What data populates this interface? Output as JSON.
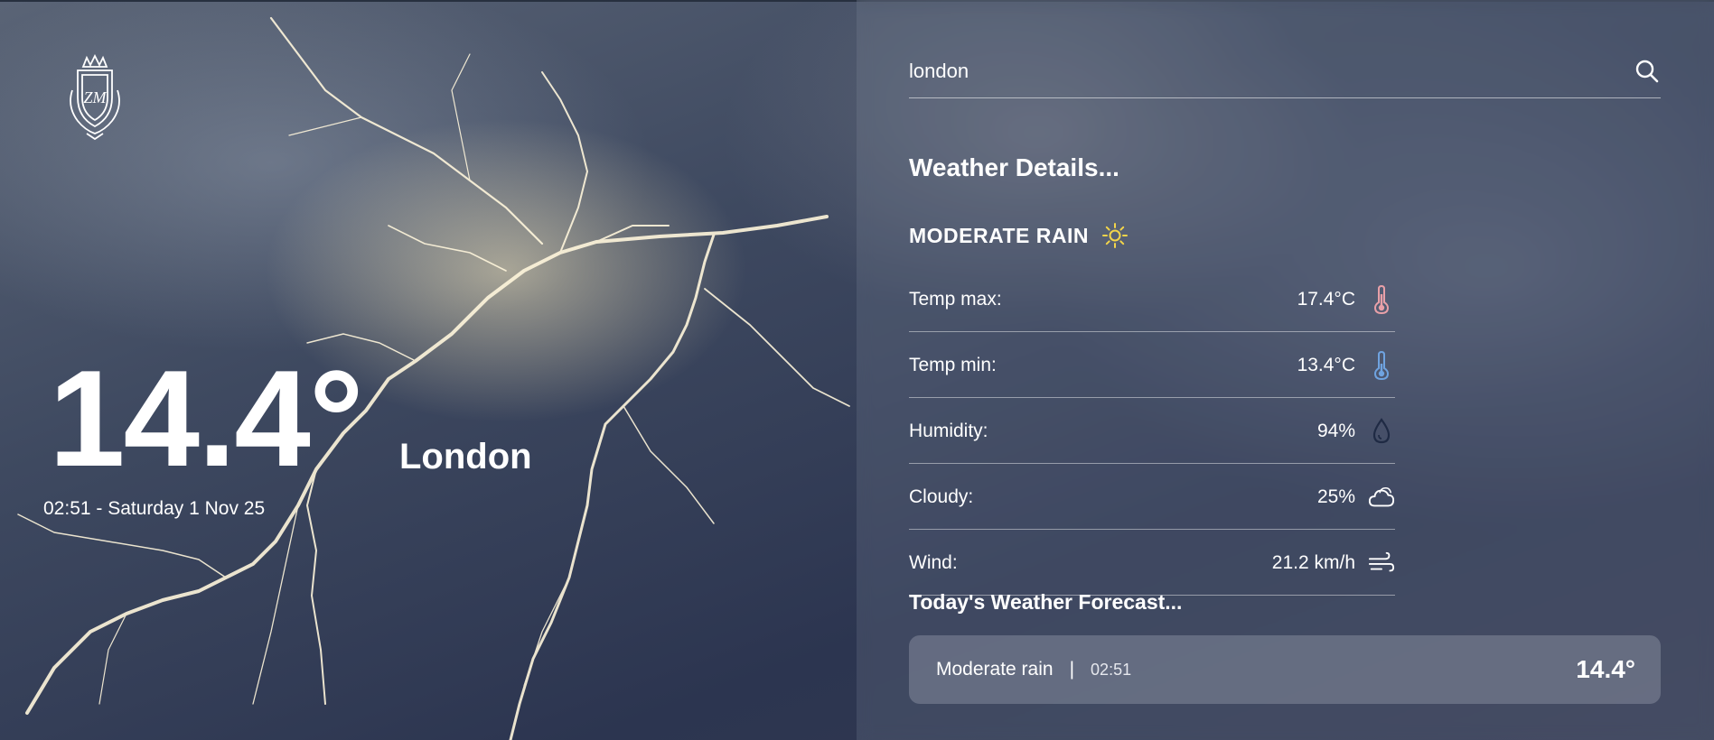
{
  "current": {
    "temperature": "14.4°",
    "city": "London",
    "datetime": "02:51 - Saturday 1 Nov 25"
  },
  "search": {
    "value": "london"
  },
  "details": {
    "title": "Weather Details...",
    "condition": "MODERATE RAIN",
    "condition_icon": "sun-icon",
    "rows": [
      {
        "label": "Temp max:",
        "value": "17.4°C",
        "icon": "thermometer-hot-icon"
      },
      {
        "label": "Temp min:",
        "value": "13.4°C",
        "icon": "thermometer-cold-icon"
      },
      {
        "label": "Humidity:",
        "value": "94%",
        "icon": "droplet-icon"
      },
      {
        "label": "Cloudy:",
        "value": "25%",
        "icon": "cloud-icon"
      },
      {
        "label": "Wind:",
        "value": "21.2 km/h",
        "icon": "wind-icon"
      }
    ]
  },
  "forecast": {
    "title": "Today's Weather Forecast...",
    "items": [
      {
        "condition": "Moderate rain",
        "separator": "|",
        "time": "02:51",
        "temp": "14.4°"
      }
    ]
  },
  "colors": {
    "hot": "#e8a0a8",
    "cold": "#6fa3e0",
    "droplet": "#1f2a44",
    "sun": "#f3d54a"
  }
}
